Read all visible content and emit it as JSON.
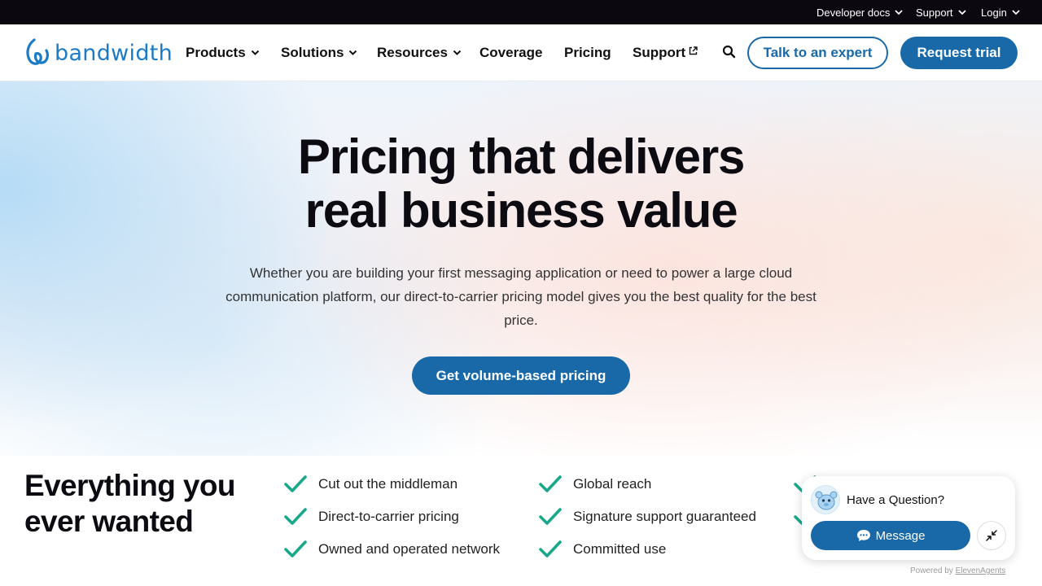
{
  "topbar": {
    "developer_docs": "Developer docs",
    "support": "Support",
    "login": "Login"
  },
  "brand": {
    "name": "bandwidth",
    "color": "#1b7bc6"
  },
  "nav": {
    "products": "Products",
    "solutions": "Solutions",
    "resources": "Resources",
    "coverage": "Coverage",
    "pricing": "Pricing",
    "support": "Support",
    "talk_to_expert": "Talk to an expert",
    "request_trial": "Request trial"
  },
  "hero": {
    "title_line1": "Pricing that delivers",
    "title_line2": "real business value",
    "subtitle_line1": "Whether you are building your first messaging application or need to power a large cloud",
    "subtitle_line2": "communication platform, our direct-to-carrier pricing model gives you the best quality for the best",
    "subtitle_line3": "price.",
    "cta": "Get volume-based pricing"
  },
  "features": {
    "title_line1": "Everything you",
    "title_line2": "ever wanted",
    "items": [
      "Cut out the middleman",
      "Direct-to-carrier pricing",
      "Owned and operated network",
      "Global reach",
      "Signature support guaranteed",
      "Committed use"
    ]
  },
  "chat": {
    "question": "Have a Question?",
    "message_button": "Message",
    "powered_by": "Powered by",
    "powered_link": "ElevenAgents"
  },
  "colors": {
    "accent": "#1969a8",
    "check": "#1aa88a",
    "topbar_bg": "#0b0810"
  },
  "icons": [
    "chevron-down-icon",
    "external-link-icon",
    "search-icon",
    "check-icon",
    "chat-bubble-icon",
    "minimize-icon"
  ]
}
